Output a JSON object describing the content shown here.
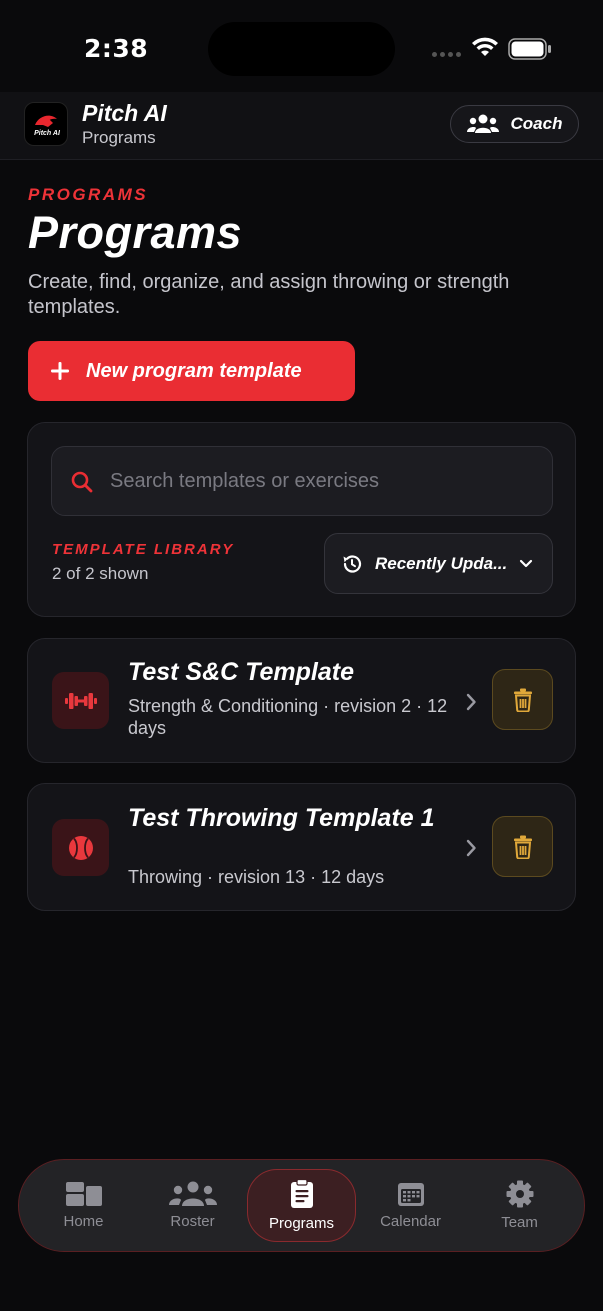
{
  "status_bar": {
    "time": "2:38"
  },
  "header": {
    "app_title": "Pitch AI",
    "app_subtitle": "Programs",
    "role_button_label": "Coach",
    "logo_text": "Pitch AI"
  },
  "hero": {
    "eyebrow": "PROGRAMS",
    "title": "Programs",
    "description": "Create, find, organize, and assign throwing or strength templates.",
    "new_button_label": "New program template"
  },
  "library": {
    "search_placeholder": "Search templates or exercises",
    "search_value": "",
    "section_label": "TEMPLATE LIBRARY",
    "count_text": "2 of 2 shown",
    "sort_label": "Recently Upda..."
  },
  "templates": [
    {
      "title": "Test S&C Template",
      "meta": "Strength & Conditioning · revision 2 · 12 days",
      "icon": "dumbbell-icon"
    },
    {
      "title": "Test Throwing Template 1",
      "meta": "Throwing · revision 13 · 12 days",
      "icon": "baseball-icon"
    }
  ],
  "tabs": [
    {
      "label": "Home",
      "icon": "home-icon",
      "active": false
    },
    {
      "label": "Roster",
      "icon": "roster-icon",
      "active": false
    },
    {
      "label": "Programs",
      "icon": "clipboard-icon",
      "active": true
    },
    {
      "label": "Calendar",
      "icon": "calendar-icon",
      "active": false
    },
    {
      "label": "Team",
      "icon": "gear-icon",
      "active": false
    }
  ],
  "colors": {
    "accent": "#ea2d33",
    "background": "#0a0a0c",
    "card": "#141418",
    "delete": "#e0a83a"
  }
}
